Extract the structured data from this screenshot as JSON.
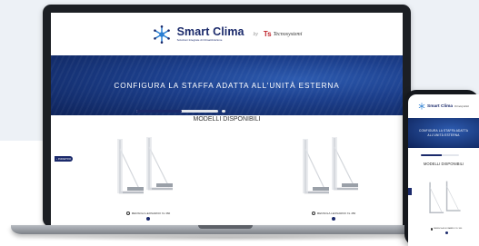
{
  "brand": {
    "title": "Smart Clima",
    "tagline": "Soluzioni Integrate di Climatizzazione",
    "by": "by",
    "partner": "Tecnosystemi",
    "partner_mark": "Ts"
  },
  "hero": {
    "title": "CONFIGURA LA STAFFA ADATTA ALL'UNITÀ ESTERNA"
  },
  "progress": {
    "value": 0.55
  },
  "section": {
    "title": "MODELLI DISPONIBILI"
  },
  "back_tab": {
    "label": "INDIETRO",
    "icon": "chevron-left-icon"
  },
  "products": [
    {
      "label": "MENSOLA LEONARDO XL 360"
    },
    {
      "label": "MENSOLA LEONARDO XL 450"
    }
  ],
  "mobile": {
    "hero_title": "CONFIGURA LA STAFFA ADATTA ALL'UNITÀ ESTERNA",
    "section_title": "MODELLI DISPONIBILI",
    "product_label": "MENSOLA LEONARDO XL 360",
    "progress": 0.55
  },
  "colors": {
    "brand_navy": "#1b2a6b",
    "hero_blue": "#1c3f8c",
    "partner_red": "#c0262d"
  }
}
